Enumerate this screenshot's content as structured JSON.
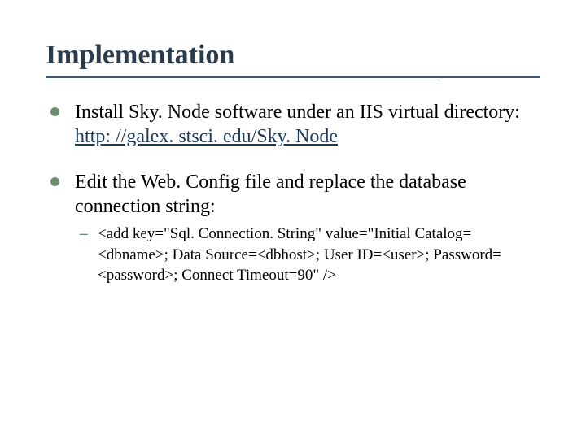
{
  "title": "Implementation",
  "bullets": [
    {
      "text_pre": "Install Sky. Node software under an IIS virtual directory: ",
      "link": "http: //galex. stsci. edu/Sky. Node"
    },
    {
      "text_pre": "Edit the Web. Config file and replace the database connection string:",
      "sub": [
        "<add key=\"Sql. Connection. String\" value=\"Initial Catalog=<dbname>; Data Source=<dbhost>; User ID=<user>; Password=<password>; Connect Timeout=90\" />"
      ]
    }
  ]
}
